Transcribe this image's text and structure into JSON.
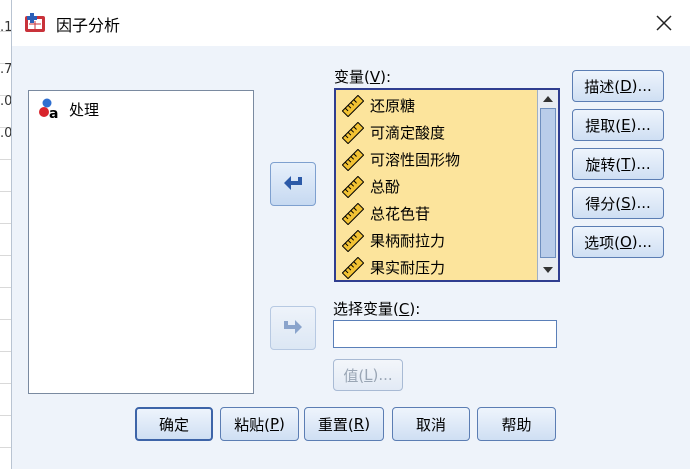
{
  "background": {
    "cells": [
      ".1",
      ".7",
      ".0",
      ".0"
    ]
  },
  "window": {
    "title": "因子分析"
  },
  "source": {
    "items": [
      {
        "label": "处理"
      }
    ]
  },
  "variables": {
    "label_prefix": "变量(",
    "label_key": "V",
    "label_suffix": "):",
    "items": [
      {
        "label": "还原糖"
      },
      {
        "label": "可滴定酸度"
      },
      {
        "label": "可溶性固形物"
      },
      {
        "label": "总酚"
      },
      {
        "label": "总花色苷"
      },
      {
        "label": "果柄耐拉力"
      },
      {
        "label": "果实耐压力"
      }
    ]
  },
  "selection": {
    "label_prefix": "选择变量(",
    "label_key": "C",
    "label_suffix": "):",
    "value": ""
  },
  "value_button": {
    "prefix": "值(",
    "key": "L",
    "suffix": ")..."
  },
  "side_buttons": [
    {
      "prefix": "描述(",
      "key": "D",
      "suffix": ")..."
    },
    {
      "prefix": "提取(",
      "key": "E",
      "suffix": ")..."
    },
    {
      "prefix": "旋转(",
      "key": "T",
      "suffix": ")..."
    },
    {
      "prefix": "得分(",
      "key": "S",
      "suffix": ")..."
    },
    {
      "prefix": "选项(",
      "key": "O",
      "suffix": ")..."
    }
  ],
  "bottom_buttons": {
    "ok": "确定",
    "paste": {
      "prefix": "粘贴(",
      "key": "P",
      "suffix": ")"
    },
    "reset": {
      "prefix": "重置(",
      "key": "R",
      "suffix": ")"
    },
    "cancel": "取消",
    "help": "帮助"
  },
  "colors": {
    "accent": "#2f3d8f",
    "list_bg": "#fce49c",
    "dialog_bg": "#eef3fa"
  }
}
